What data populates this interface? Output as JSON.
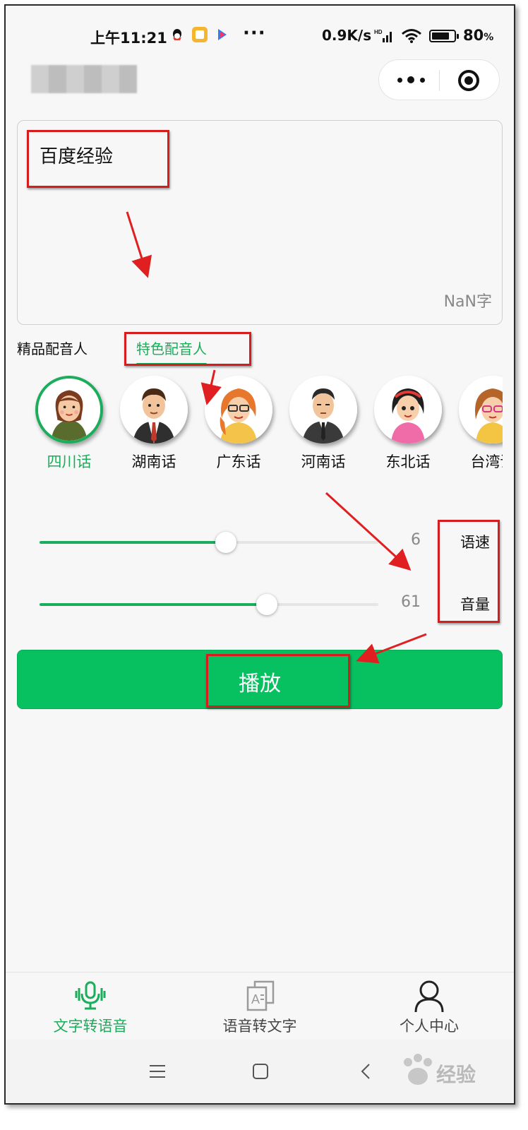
{
  "status_bar": {
    "time": "上午11:21",
    "network_speed": "0.9K/s",
    "battery_percent": "80",
    "battery_percent_suffix": "%",
    "battery_level": 0.8,
    "more_dots": "···"
  },
  "text_input": {
    "content": "百度经验",
    "char_count": "NaN字"
  },
  "voice_tabs": [
    {
      "label": "精品配音人",
      "active": false
    },
    {
      "label": "特色配音人",
      "active": true
    }
  ],
  "voices": [
    {
      "label": "四川话",
      "selected": true,
      "icon": "sichuan-avatar-icon"
    },
    {
      "label": "湖南话",
      "selected": false,
      "icon": "hunan-avatar-icon"
    },
    {
      "label": "广东话",
      "selected": false,
      "icon": "guangdong-avatar-icon"
    },
    {
      "label": "河南话",
      "selected": false,
      "icon": "henan-avatar-icon"
    },
    {
      "label": "东北话",
      "selected": false,
      "icon": "dongbei-avatar-icon"
    },
    {
      "label": "台湾话",
      "selected": false,
      "icon": "taiwan-avatar-icon"
    }
  ],
  "sliders": {
    "speed": {
      "label": "语速",
      "value": "6",
      "fraction": 0.55
    },
    "volume": {
      "label": "音量",
      "value": "61",
      "fraction": 0.67
    }
  },
  "play_button": {
    "label": "播放"
  },
  "bottom_nav": [
    {
      "label": "文字转语音",
      "active": true,
      "icon": "microphone-icon"
    },
    {
      "label": "语音转文字",
      "active": false,
      "icon": "document-text-icon"
    },
    {
      "label": "个人中心",
      "active": false,
      "icon": "person-icon"
    }
  ],
  "watermark": {
    "text": "经验"
  },
  "colors": {
    "accent_green": "#1aad5b",
    "button_green": "#07c160",
    "annotation_red": "#d61c1c"
  }
}
